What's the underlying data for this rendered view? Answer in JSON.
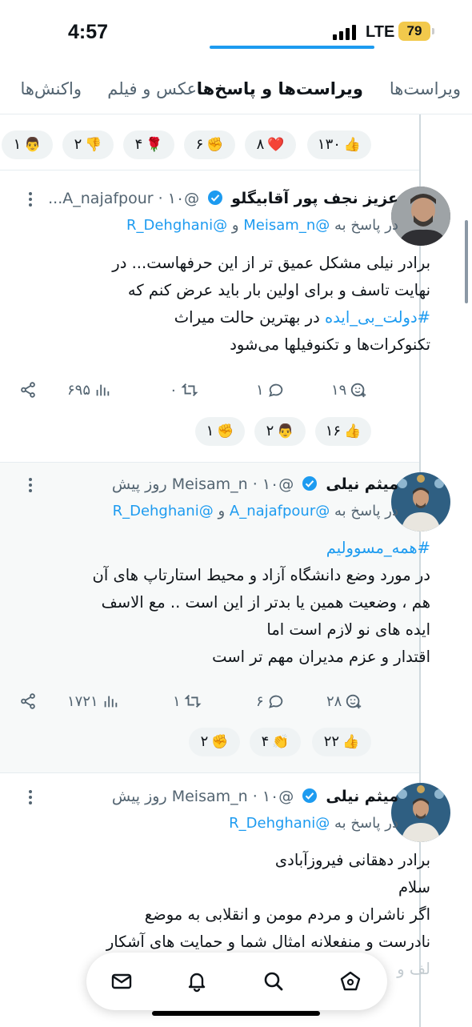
{
  "status": {
    "time": "4:57",
    "network": "LTE",
    "battery": "79"
  },
  "tabs": [
    {
      "label": "ویراست‌ها"
    },
    {
      "label": "ویراست‌ها و پاسخ‌ها"
    },
    {
      "label": "عکس و فیلم"
    },
    {
      "label": "واکنش‌ها"
    }
  ],
  "top_reactions": [
    {
      "emoji": "👍",
      "count": "۱۳۰"
    },
    {
      "emoji": "❤️",
      "count": "۸"
    },
    {
      "emoji": "✊",
      "count": "۶"
    },
    {
      "emoji": "🌹",
      "count": "۴"
    },
    {
      "emoji": "👎",
      "count": "۲"
    },
    {
      "emoji": "👨",
      "count": "۱"
    }
  ],
  "tweets": [
    {
      "name": "عزیز نجف پور آقابیگلو",
      "handle": "@A_najafpour",
      "time": "۱۰...",
      "reply_prefix": "در پاسخ به",
      "mention1": "@Meisam_n",
      "and": "و",
      "mention2": "@R_Dehghani",
      "line1": "برادر نیلی مشکل عمیق تر از این حرفهاست... در",
      "line2": "نهایت تاسف و برای اولین بار باید عرض کنم که",
      "hashtag": "#دولت_بی_ایده",
      "line3_rest": " در بهترین حالت میراث",
      "line4": "تکنوکرات‌ها و تکنوفیلها می‌شود",
      "likes": "۱۹",
      "replies": "۱",
      "reposts": "۰",
      "views": "۶۹۵",
      "reactions": [
        {
          "emoji": "👍",
          "count": "۱۶"
        },
        {
          "emoji": "👨",
          "count": "۲"
        },
        {
          "emoji": "✊",
          "count": "۱"
        }
      ]
    },
    {
      "name": "میثم نیلی",
      "handle": "@Meisam_n",
      "time": "۱۰ روز پیش",
      "reply_prefix": "در پاسخ به",
      "mention1": "@A_najafpour",
      "and": "و",
      "mention2": "@R_Dehghani",
      "hashtag": "#همه_مسوولیم",
      "line1": "در مورد وضع دانشگاه آزاد و محیط استارتاپ های آن",
      "line2": "هم ، وضعیت همین یا بدتر از این است .. مع الاسف",
      "line3": "ایده های نو لازم است اما",
      "line4": "اقتدار و عزم مدیران مهم تر است",
      "likes": "۲۸",
      "replies": "۶",
      "reposts": "۱",
      "views": "۱۷۲۱",
      "reactions": [
        {
          "emoji": "👍",
          "count": "۲۲"
        },
        {
          "emoji": "👏",
          "count": "۴"
        },
        {
          "emoji": "✊",
          "count": "۲"
        }
      ]
    },
    {
      "name": "میثم نیلی",
      "handle": "@Meisam_n",
      "time": "۱۰ روز پیش",
      "reply_prefix": "در پاسخ به",
      "mention1": "@R_Dehghani",
      "line1": "برادر دهقانی فیروزآبادی",
      "line2": "سلام",
      "line3": "اگر ناشران و مردم مومن و انقلابی به موضع",
      "line4": "نادرست و منفعلانه امثال شما و حمایت های آشکار",
      "line5": "لف و"
    }
  ],
  "icons": {
    "nav": [
      "mail-icon",
      "bell-icon",
      "search-icon",
      "home-icon"
    ],
    "actions": [
      "share-icon",
      "views-icon",
      "repost-icon",
      "reply-icon",
      "add-reaction-icon"
    ]
  },
  "colors": {
    "accent": "#1d9bf0",
    "battery": "#f2c94c",
    "muted": "#536471"
  }
}
